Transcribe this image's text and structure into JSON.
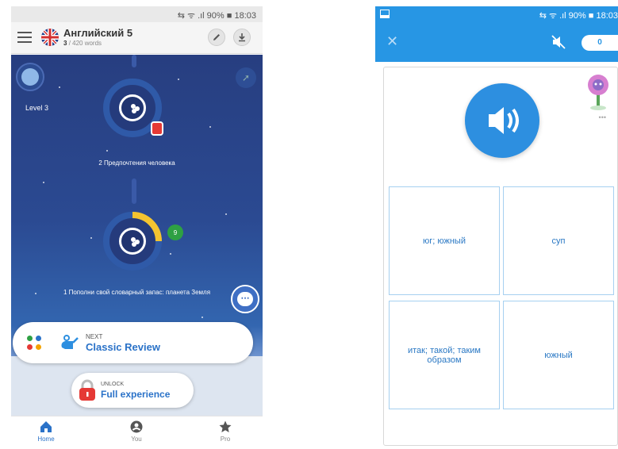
{
  "left": {
    "status_bar": {
      "right_text": "⇆ ᯤ .ıl 90% ■ 18:03"
    },
    "header": {
      "title": "Английский 5",
      "progress_count": "3",
      "progress_total": "/ 420 words"
    },
    "level_label": "Level 3",
    "lessons": [
      {
        "title": "2 Предпочтения человека"
      },
      {
        "title": "1 Пополни свой словарный запас: планета Земля",
        "badge": "9"
      }
    ],
    "next_card": {
      "small": "NEXT",
      "label": "Classic Review"
    },
    "unlock_card": {
      "small": "UNLOCK",
      "label": "Full experience"
    },
    "nav": [
      {
        "label": "Home"
      },
      {
        "label": "You"
      },
      {
        "label": "Pro"
      }
    ],
    "colors": {
      "accent": "#2a72c8",
      "space_top": "#273e80",
      "lock_red": "#e53935",
      "badge_green": "#2ea043"
    }
  },
  "right": {
    "status_bar": {
      "right_text": "⇆ ᯤ .ıl 90% ■ 18:03"
    },
    "score": "0",
    "choices": [
      {
        "label": "юг; южный"
      },
      {
        "label": "суп"
      },
      {
        "label": "итак; такой; таким образом"
      },
      {
        "label": "южный"
      }
    ],
    "avatar_dots": "•••",
    "colors": {
      "toolbar": "#2796e4",
      "choice_text": "#2a78c4",
      "choice_border": "#a6d0f0"
    }
  }
}
